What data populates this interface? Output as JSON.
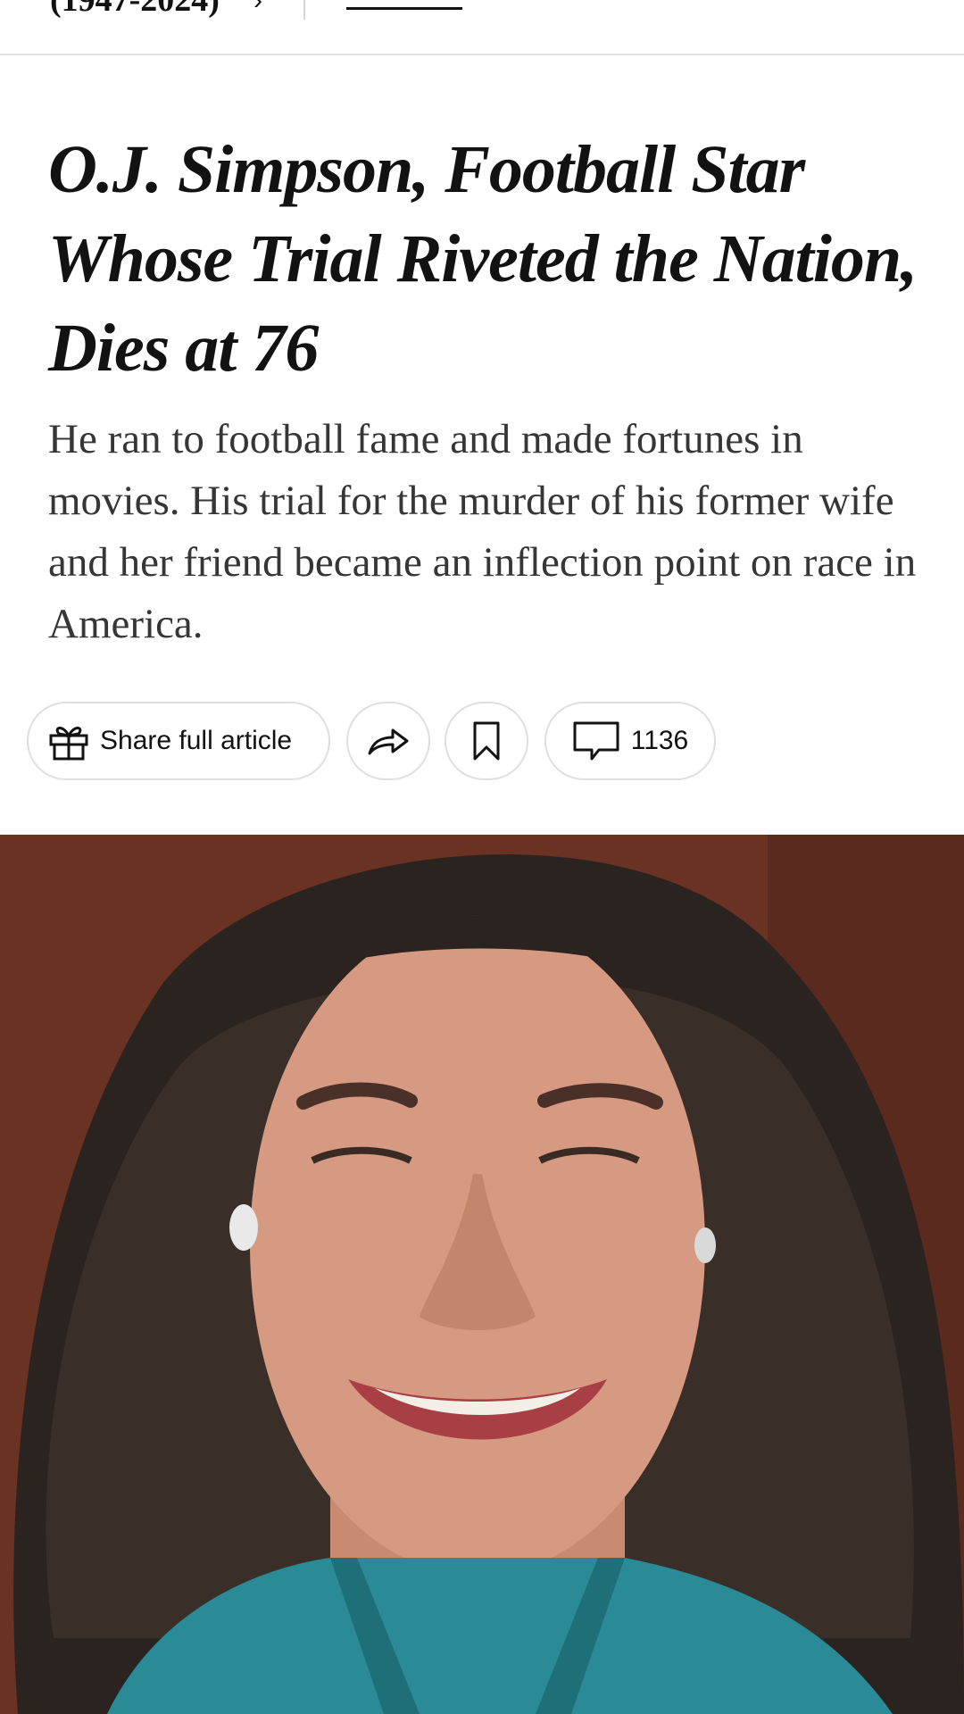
{
  "breadcrumb": {
    "text": "(1947-2024)",
    "chevron": "›"
  },
  "article": {
    "headline": "O.J. Simpson, Football Star Whose Trial Riveted the Nation, Dies at 76",
    "summary": "He ran to football fame and made fortunes in movies. His trial for the murder of his former wife and her friend became an inflection point on race in America."
  },
  "actions": {
    "share_label": "Share full article",
    "share_icon": "gift-icon",
    "forward_icon": "share-arrow-icon",
    "bookmark_icon": "bookmark-icon",
    "comments_icon": "comment-icon",
    "comments_count": "1136"
  },
  "overlay": {
    "type": "front-camera video of a smiling person with long curly dark hair",
    "background_color": "#6b3322"
  }
}
